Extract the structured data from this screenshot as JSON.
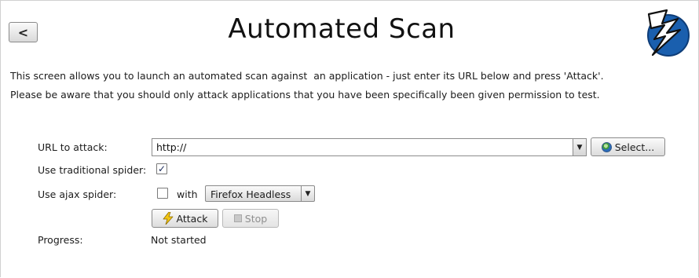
{
  "header": {
    "back_label": "<",
    "title": "Automated Scan"
  },
  "description": {
    "line1": "This screen allows you to launch an automated scan against  an application - just enter its URL below and press 'Attack'.",
    "line2": "Please be aware that you should only attack applications that you have been specifically been given permission to test."
  },
  "form": {
    "url_label": "URL to attack:",
    "url_value": "http://",
    "select_label": "Select...",
    "traditional_spider_label": "Use traditional spider:",
    "traditional_spider_checked": true,
    "ajax_spider_label": "Use ajax spider:",
    "ajax_spider_checked": false,
    "with_label": "with",
    "browser_value": "Firefox Headless",
    "attack_label": "Attack",
    "stop_label": "Stop",
    "progress_label": "Progress:",
    "progress_value": "Not started"
  },
  "icons": {
    "logo": "zap-lightning-logo-icon",
    "select": "globe-icon",
    "attack": "lightning-icon",
    "stop": "stop-icon"
  },
  "colors": {
    "logo_blue": "#1a5fae",
    "check_mark": "#1a2a5a"
  }
}
